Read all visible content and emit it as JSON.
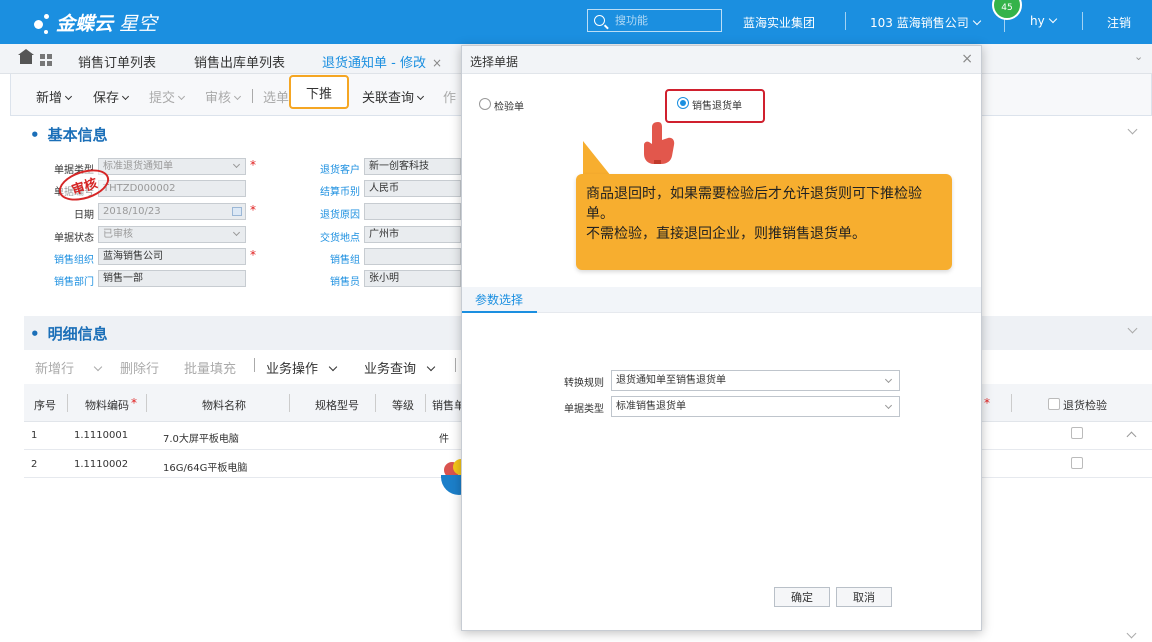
{
  "topbar": {
    "brand": "金蝶云",
    "brand_sub": "星空",
    "search_placeholder": "搜功能",
    "org_group": "蓝海实业集团",
    "org_company": "103 蓝海销售公司",
    "notification_count": "45",
    "user": "hy",
    "logout": "注销"
  },
  "tabs": [
    {
      "label": "销售订单列表"
    },
    {
      "label": "销售出库单列表"
    },
    {
      "label": "退货通知单 - 修改",
      "close": "×"
    }
  ],
  "toolbar": {
    "add": "新增",
    "save": "保存",
    "submit": "提交",
    "audit": "审核",
    "choose": "选单",
    "push": "下推",
    "related_query": "关联查询",
    "more": "作"
  },
  "basic_section": {
    "title": "基本信息",
    "fields": {
      "doc_type_label": "单据类型",
      "doc_type_value": "标准退货通知单",
      "doc_no_label": "单据编号",
      "doc_no_value": "THTZD000002",
      "date_label": "日期",
      "date_value": "2018/10/23",
      "status_label": "单据状态",
      "status_value": "已审核",
      "sales_org_label": "销售组织",
      "sales_org_value": "蓝海销售公司",
      "sales_dept_label": "销售部门",
      "sales_dept_value": "销售一部",
      "return_customer_label": "退货客户",
      "return_customer_value": "新一创客科技",
      "currency_label": "结算币别",
      "currency_value": "人民币",
      "return_reason_label": "退货原因",
      "return_reason_value": "",
      "delivery_place_label": "交货地点",
      "delivery_place_value": "广州市",
      "sales_group_label": "销售组",
      "sales_group_value": "",
      "salesperson_label": "销售员",
      "salesperson_value": "张小明"
    },
    "stamp": "审核"
  },
  "detail_section": {
    "title": "明细信息",
    "tools": {
      "add_row": "新增行",
      "delete_row": "删除行",
      "batch_fill": "批量填充",
      "biz_ops": "业务操作",
      "biz_query": "业务查询"
    },
    "columns": {
      "seq": "序号",
      "material_code": "物料编码",
      "material_name": "物料名称",
      "spec": "规格型号",
      "grade": "等级",
      "sales_unit": "销售单",
      "return_check": "退货检验"
    },
    "rows": [
      {
        "seq": "1",
        "code": "1.1110001",
        "name": "7.0大屏平板电脑",
        "unit": "件"
      },
      {
        "seq": "2",
        "code": "1.1110002",
        "name": "16G/64G平板电脑",
        "unit": ""
      }
    ]
  },
  "dialog": {
    "title": "选择单据",
    "close": "×",
    "option_inspection": "检验单",
    "option_sales_return": "销售退货单",
    "tip_line1": "商品退回时，如果需要检验后才允许退货则可下推检验单。",
    "tip_line2": "不需检验，直接退回企业，则推销售退货单。",
    "param_tab": "参数选择",
    "convert_rule_label": "转换规则",
    "convert_rule_value": "退货通知单至销售退货单",
    "doc_type_label": "单据类型",
    "doc_type_value": "标准销售退货单",
    "ok": "确定",
    "cancel": "取消"
  },
  "colors": {
    "brand_blue": "#1b8fe0",
    "highlight_orange": "#f5a623",
    "highlight_red": "#d0202e",
    "tip_bg": "#f7ae2f"
  }
}
